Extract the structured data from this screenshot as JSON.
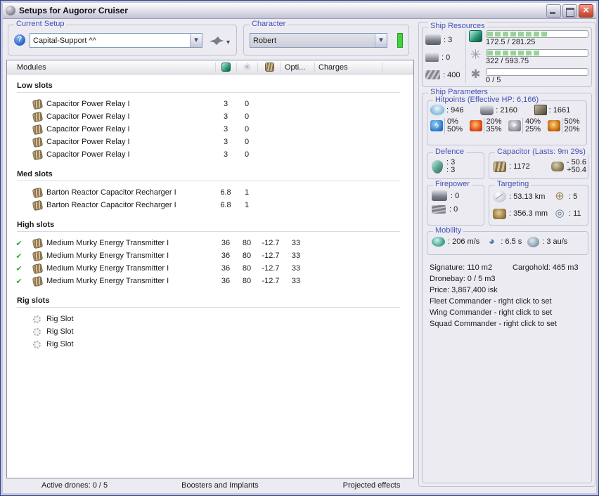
{
  "window": {
    "title": "Setups for Augoror Cruiser"
  },
  "setup": {
    "label": "Current Setup",
    "value": "Capital-Support ^^"
  },
  "character": {
    "label": "Character",
    "value": "Robert"
  },
  "modules_table": {
    "header": {
      "modules": "Modules",
      "opti": "Opti...",
      "charges": "Charges",
      "icons": [
        "cpu-icon",
        "powergrid-icon",
        "capacitor-icon"
      ]
    },
    "sections": [
      {
        "label": "Low slots",
        "icon": "module",
        "rows": [
          {
            "name": "Capacitor Power Relay I",
            "v1": "3",
            "v2": "0",
            "v3": "",
            "v4": ""
          },
          {
            "name": "Capacitor Power Relay I",
            "v1": "3",
            "v2": "0",
            "v3": "",
            "v4": ""
          },
          {
            "name": "Capacitor Power Relay I",
            "v1": "3",
            "v2": "0",
            "v3": "",
            "v4": ""
          },
          {
            "name": "Capacitor Power Relay I",
            "v1": "3",
            "v2": "0",
            "v3": "",
            "v4": ""
          },
          {
            "name": "Capacitor Power Relay I",
            "v1": "3",
            "v2": "0",
            "v3": "",
            "v4": ""
          }
        ]
      },
      {
        "label": "Med slots",
        "icon": "module",
        "rows": [
          {
            "name": "Barton Reactor Capacitor Recharger I",
            "v1": "6.8",
            "v2": "1",
            "v3": "",
            "v4": ""
          },
          {
            "name": "Barton Reactor Capacitor Recharger I",
            "v1": "6.8",
            "v2": "1",
            "v3": "",
            "v4": ""
          }
        ]
      },
      {
        "label": "High slots",
        "icon": "module",
        "rows": [
          {
            "name": "Medium Murky Energy Transmitter I",
            "checked": true,
            "v1": "36",
            "v2": "80",
            "v3": "-12.7",
            "v4": "33"
          },
          {
            "name": "Medium Murky Energy Transmitter I",
            "checked": true,
            "v1": "36",
            "v2": "80",
            "v3": "-12.7",
            "v4": "33"
          },
          {
            "name": "Medium Murky Energy Transmitter I",
            "checked": true,
            "v1": "36",
            "v2": "80",
            "v3": "-12.7",
            "v4": "33"
          },
          {
            "name": "Medium Murky Energy Transmitter I",
            "checked": true,
            "v1": "36",
            "v2": "80",
            "v3": "-12.7",
            "v4": "33"
          }
        ]
      },
      {
        "label": "Rig slots",
        "icon": "rig",
        "rows": [
          {
            "name": "Rig Slot"
          },
          {
            "name": "Rig Slot"
          },
          {
            "name": "Rig Slot"
          }
        ]
      }
    ]
  },
  "resources": {
    "label": "Ship Resources",
    "turrets": ": 3",
    "launchers": ": 0",
    "calibration": ": 400",
    "cpu": {
      "text": "172.5 / 281.25",
      "pct": 61.3
    },
    "powergrid": {
      "text": "322 / 593.75",
      "pct": 54.2
    },
    "drones": {
      "text": "0 / 5",
      "pct": 0
    }
  },
  "parameters": {
    "label": "Ship Parameters",
    "hitpoints": {
      "label": "Hitpoints (Effective HP: 6,166)",
      "shield": ": 946",
      "armor": ": 2160",
      "structure": ": 1661",
      "resists": [
        {
          "name": "em",
          "top": "0%",
          "bottom": "50%"
        },
        {
          "name": "thermal",
          "top": "20%",
          "bottom": "35%"
        },
        {
          "name": "kinetic",
          "top": "40%",
          "bottom": "25%"
        },
        {
          "name": "explosive",
          "top": "50%",
          "bottom": "20%"
        }
      ]
    },
    "defence": {
      "label": "Defence",
      "line1": ": 3",
      "line2": ": 3"
    },
    "capacitor": {
      "label": "Capacitor (Lasts: 9m 29s)",
      "amount": ": 1172",
      "peak_neg": "- 50.6",
      "peak_pos": "+50.4"
    },
    "firepower": {
      "label": "Firepower",
      "turret": ": 0",
      "missile": ": 0"
    },
    "targeting": {
      "label": "Targeting",
      "range": ": 53.13 km",
      "scan_res": ": 356.3 mm",
      "max_targets": ": 5",
      "sensor_strength": ": 11"
    },
    "mobility": {
      "label": "Mobility",
      "speed": ": 206 m/s",
      "align_time": ": 6.5 s",
      "warp_speed": ": 3 au/s"
    },
    "info": {
      "signature": "Signature: 110 m2",
      "cargohold": "Cargohold: 465 m3",
      "dronebay": "Dronebay: 0 / 5 m3",
      "price": "Price: 3,867,400 isk",
      "fleet": "Fleet Commander - right click to set",
      "wing": "Wing Commander - right click to set",
      "squad": "Squad Commander - right click to set"
    }
  },
  "footer": {
    "active_drones": "Active drones: 0 / 5",
    "boosters": "Boosters and Implants",
    "projected": "Projected effects"
  }
}
